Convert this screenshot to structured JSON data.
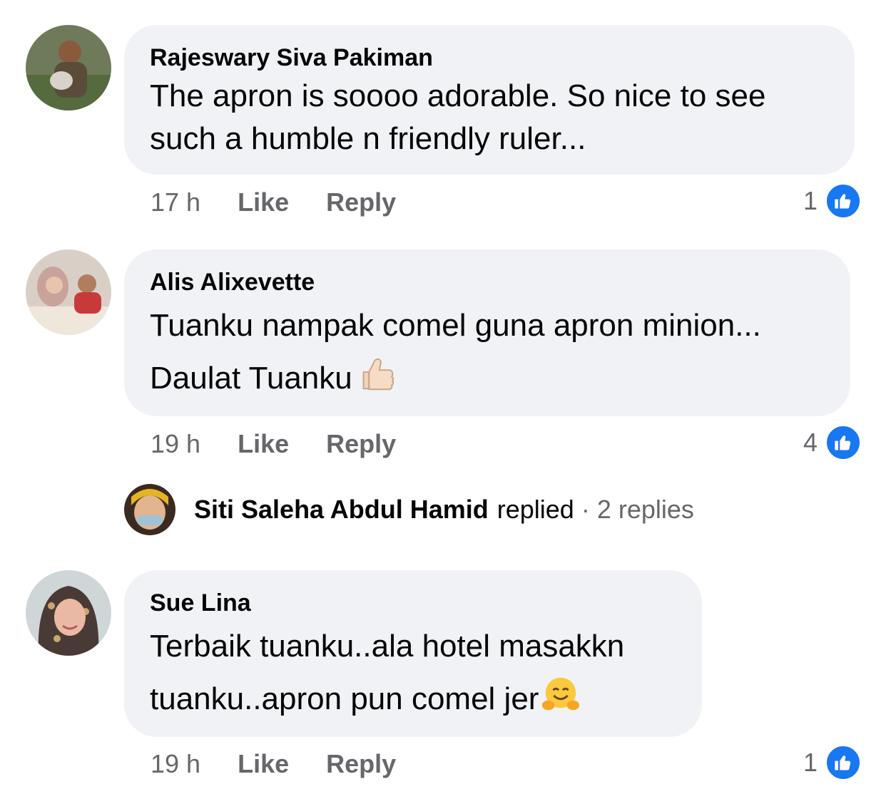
{
  "comments": [
    {
      "author": "Rajeswary Siva Pakiman",
      "lines": [
        "The apron is soooo adorable. So nice to see",
        "such a humble n friendly ruler..."
      ],
      "time": "17 h",
      "like_label": "Like",
      "reply_label": "Reply",
      "reaction_count": "1"
    },
    {
      "author": "Alis Alixevette",
      "lines": [
        "Tuanku nampak comel guna apron minion...",
        "Daulat Tuanku"
      ],
      "time": "19 h",
      "like_label": "Like",
      "reply_label": "Reply",
      "reaction_count": "4"
    },
    {
      "author": "Sue Lina",
      "lines": [
        "Terbaik tuanku..ala hotel masakkn",
        "tuanku..apron pun comel jer"
      ],
      "time": "19 h",
      "like_label": "Like",
      "reply_label": "Reply",
      "reaction_count": "1"
    }
  ],
  "reply_summary": {
    "name": "Siti Saleha Abdul Hamid",
    "action": "replied",
    "separator": "·",
    "count": "2 replies"
  },
  "icons": {
    "reaction": "like-thumbs-up-icon",
    "emoji_comment_2": "thumbs-up-emoji-icon",
    "emoji_comment_3": "hugging-face-emoji-icon"
  },
  "colors": {
    "bubble": "#f0f2f5",
    "meta_text": "#65676b",
    "like_badge": "#1877f2",
    "text": "#050505"
  }
}
